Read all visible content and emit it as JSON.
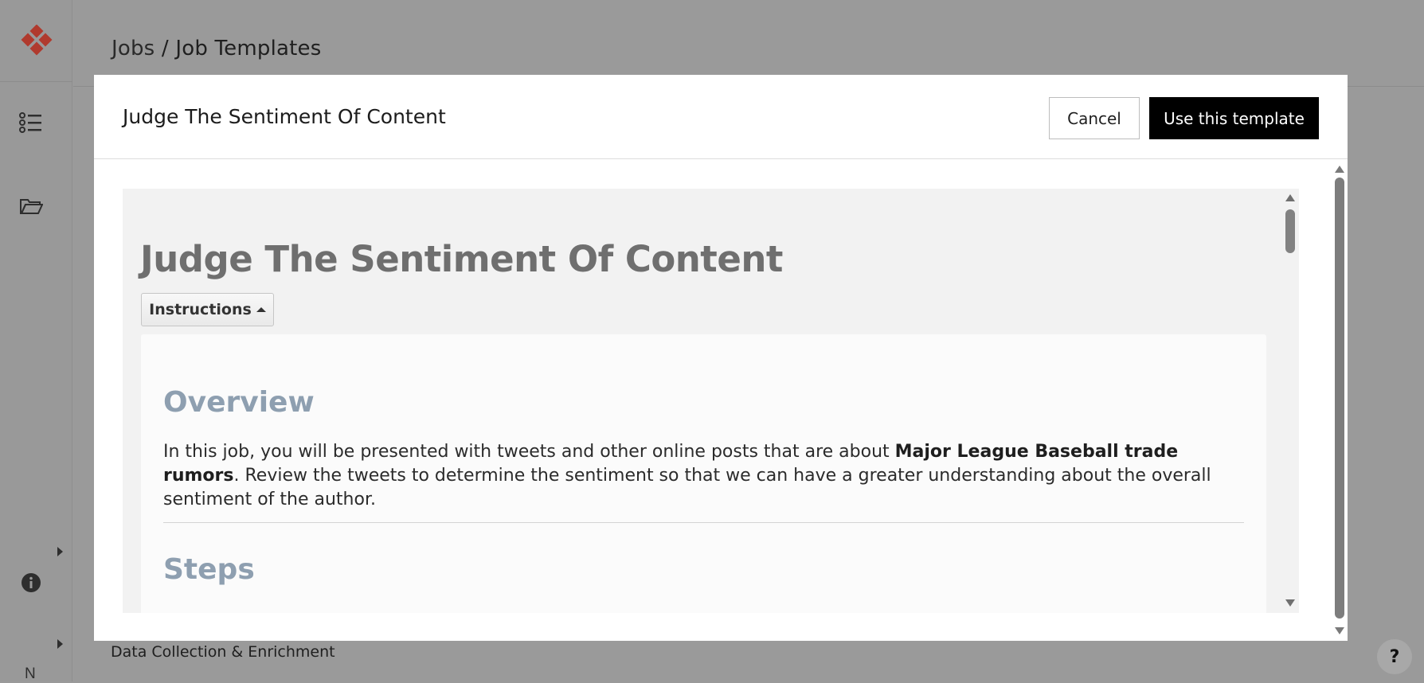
{
  "app": {
    "breadcrumb": {
      "parent": "Jobs",
      "separator": "/",
      "current": "Job Templates"
    },
    "bottom_label": "Data Collection & Enrichment",
    "sidebar_letter": "N",
    "help_label": "?",
    "brand_color": "#c0392b"
  },
  "modal": {
    "title": "Judge The Sentiment Of Content",
    "cancel_label": "Cancel",
    "use_label": "Use this template"
  },
  "preview": {
    "title": "Judge The Sentiment Of Content",
    "instructions_label": "Instructions",
    "overview_heading": "Overview",
    "overview_text_1": "In this job, you will be presented with tweets and other online posts that are about ",
    "overview_bold": "Major League Baseball trade rumors",
    "overview_text_2": ". Review the tweets to determine the sentiment so that we can have a greater understanding about the overall sentiment of the author.",
    "steps_heading": "Steps"
  },
  "icons": [
    "logo-icon",
    "list-icon",
    "folder-icon",
    "info-icon",
    "caret-right-icon",
    "caret-up-icon",
    "help-icon"
  ]
}
